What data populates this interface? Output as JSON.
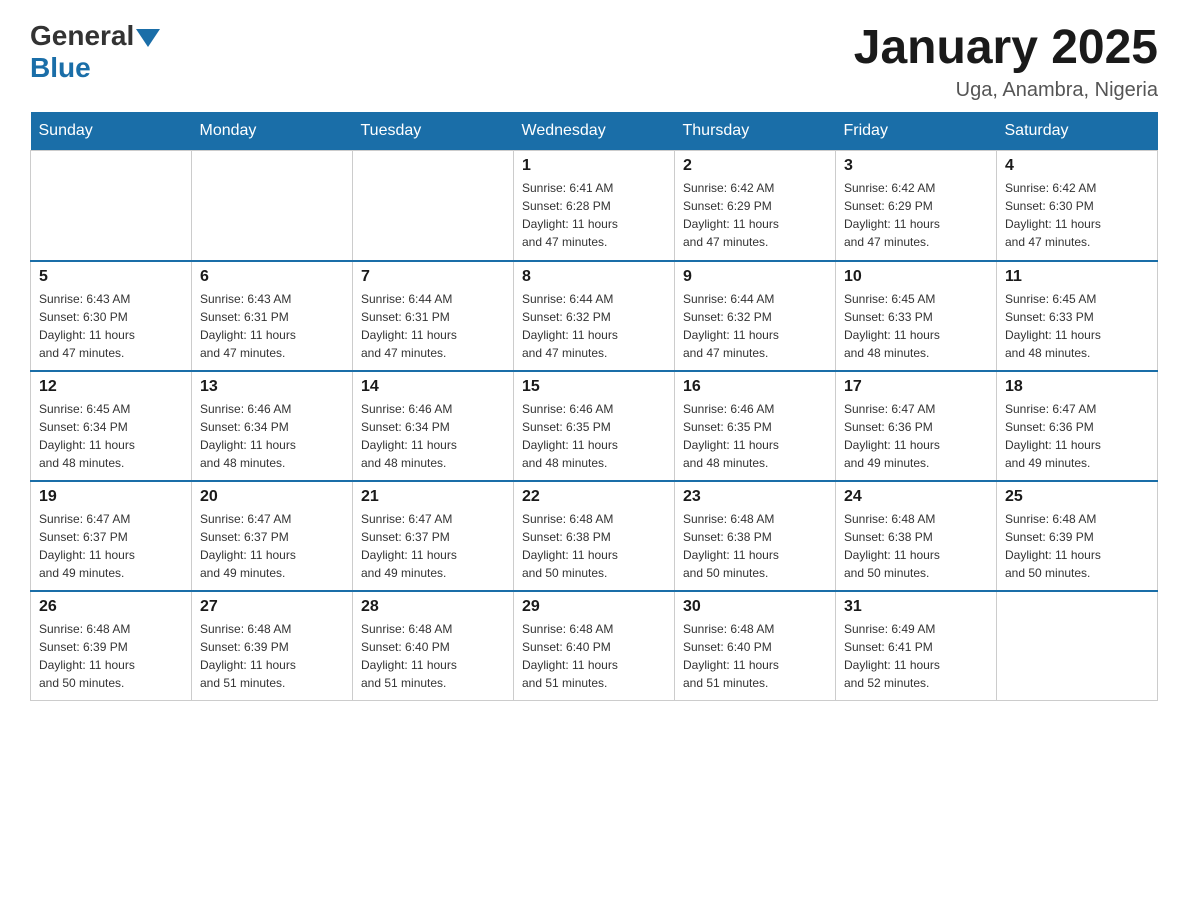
{
  "header": {
    "logo": {
      "general": "General",
      "blue": "Blue"
    },
    "title": "January 2025",
    "location": "Uga, Anambra, Nigeria"
  },
  "days_of_week": [
    "Sunday",
    "Monday",
    "Tuesday",
    "Wednesday",
    "Thursday",
    "Friday",
    "Saturday"
  ],
  "weeks": [
    [
      {
        "day": "",
        "info": ""
      },
      {
        "day": "",
        "info": ""
      },
      {
        "day": "",
        "info": ""
      },
      {
        "day": "1",
        "info": "Sunrise: 6:41 AM\nSunset: 6:28 PM\nDaylight: 11 hours\nand 47 minutes."
      },
      {
        "day": "2",
        "info": "Sunrise: 6:42 AM\nSunset: 6:29 PM\nDaylight: 11 hours\nand 47 minutes."
      },
      {
        "day": "3",
        "info": "Sunrise: 6:42 AM\nSunset: 6:29 PM\nDaylight: 11 hours\nand 47 minutes."
      },
      {
        "day": "4",
        "info": "Sunrise: 6:42 AM\nSunset: 6:30 PM\nDaylight: 11 hours\nand 47 minutes."
      }
    ],
    [
      {
        "day": "5",
        "info": "Sunrise: 6:43 AM\nSunset: 6:30 PM\nDaylight: 11 hours\nand 47 minutes."
      },
      {
        "day": "6",
        "info": "Sunrise: 6:43 AM\nSunset: 6:31 PM\nDaylight: 11 hours\nand 47 minutes."
      },
      {
        "day": "7",
        "info": "Sunrise: 6:44 AM\nSunset: 6:31 PM\nDaylight: 11 hours\nand 47 minutes."
      },
      {
        "day": "8",
        "info": "Sunrise: 6:44 AM\nSunset: 6:32 PM\nDaylight: 11 hours\nand 47 minutes."
      },
      {
        "day": "9",
        "info": "Sunrise: 6:44 AM\nSunset: 6:32 PM\nDaylight: 11 hours\nand 47 minutes."
      },
      {
        "day": "10",
        "info": "Sunrise: 6:45 AM\nSunset: 6:33 PM\nDaylight: 11 hours\nand 48 minutes."
      },
      {
        "day": "11",
        "info": "Sunrise: 6:45 AM\nSunset: 6:33 PM\nDaylight: 11 hours\nand 48 minutes."
      }
    ],
    [
      {
        "day": "12",
        "info": "Sunrise: 6:45 AM\nSunset: 6:34 PM\nDaylight: 11 hours\nand 48 minutes."
      },
      {
        "day": "13",
        "info": "Sunrise: 6:46 AM\nSunset: 6:34 PM\nDaylight: 11 hours\nand 48 minutes."
      },
      {
        "day": "14",
        "info": "Sunrise: 6:46 AM\nSunset: 6:34 PM\nDaylight: 11 hours\nand 48 minutes."
      },
      {
        "day": "15",
        "info": "Sunrise: 6:46 AM\nSunset: 6:35 PM\nDaylight: 11 hours\nand 48 minutes."
      },
      {
        "day": "16",
        "info": "Sunrise: 6:46 AM\nSunset: 6:35 PM\nDaylight: 11 hours\nand 48 minutes."
      },
      {
        "day": "17",
        "info": "Sunrise: 6:47 AM\nSunset: 6:36 PM\nDaylight: 11 hours\nand 49 minutes."
      },
      {
        "day": "18",
        "info": "Sunrise: 6:47 AM\nSunset: 6:36 PM\nDaylight: 11 hours\nand 49 minutes."
      }
    ],
    [
      {
        "day": "19",
        "info": "Sunrise: 6:47 AM\nSunset: 6:37 PM\nDaylight: 11 hours\nand 49 minutes."
      },
      {
        "day": "20",
        "info": "Sunrise: 6:47 AM\nSunset: 6:37 PM\nDaylight: 11 hours\nand 49 minutes."
      },
      {
        "day": "21",
        "info": "Sunrise: 6:47 AM\nSunset: 6:37 PM\nDaylight: 11 hours\nand 49 minutes."
      },
      {
        "day": "22",
        "info": "Sunrise: 6:48 AM\nSunset: 6:38 PM\nDaylight: 11 hours\nand 50 minutes."
      },
      {
        "day": "23",
        "info": "Sunrise: 6:48 AM\nSunset: 6:38 PM\nDaylight: 11 hours\nand 50 minutes."
      },
      {
        "day": "24",
        "info": "Sunrise: 6:48 AM\nSunset: 6:38 PM\nDaylight: 11 hours\nand 50 minutes."
      },
      {
        "day": "25",
        "info": "Sunrise: 6:48 AM\nSunset: 6:39 PM\nDaylight: 11 hours\nand 50 minutes."
      }
    ],
    [
      {
        "day": "26",
        "info": "Sunrise: 6:48 AM\nSunset: 6:39 PM\nDaylight: 11 hours\nand 50 minutes."
      },
      {
        "day": "27",
        "info": "Sunrise: 6:48 AM\nSunset: 6:39 PM\nDaylight: 11 hours\nand 51 minutes."
      },
      {
        "day": "28",
        "info": "Sunrise: 6:48 AM\nSunset: 6:40 PM\nDaylight: 11 hours\nand 51 minutes."
      },
      {
        "day": "29",
        "info": "Sunrise: 6:48 AM\nSunset: 6:40 PM\nDaylight: 11 hours\nand 51 minutes."
      },
      {
        "day": "30",
        "info": "Sunrise: 6:48 AM\nSunset: 6:40 PM\nDaylight: 11 hours\nand 51 minutes."
      },
      {
        "day": "31",
        "info": "Sunrise: 6:49 AM\nSunset: 6:41 PM\nDaylight: 11 hours\nand 52 minutes."
      },
      {
        "day": "",
        "info": ""
      }
    ]
  ]
}
